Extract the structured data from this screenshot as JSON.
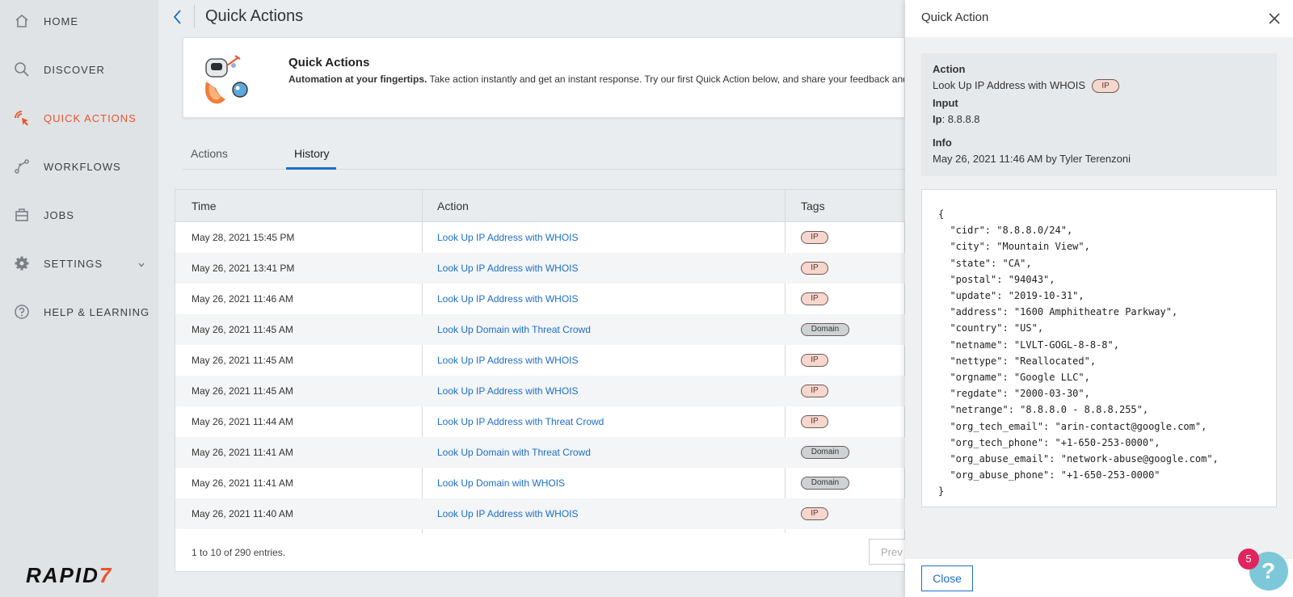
{
  "colors": {
    "accent": "#e8542b",
    "link": "#1c6ec6",
    "ip_tag": "#f6d6cd",
    "domain_tag": "#cfd2d4"
  },
  "sidebar": {
    "items": [
      {
        "label": "HOME",
        "icon": "home-icon",
        "active": false
      },
      {
        "label": "DISCOVER",
        "icon": "search-icon",
        "active": false
      },
      {
        "label": "QUICK ACTIONS",
        "icon": "cursor-click-icon",
        "active": true
      },
      {
        "label": "WORKFLOWS",
        "icon": "workflow-icon",
        "active": false
      },
      {
        "label": "JOBS",
        "icon": "briefcase-icon",
        "active": false
      },
      {
        "label": "SETTINGS",
        "icon": "gear-icon",
        "active": false
      },
      {
        "label": "HELP & LEARNING",
        "icon": "help-circle-icon",
        "active": false
      }
    ],
    "logo_text": "RAPID",
    "logo_seven": "7"
  },
  "header": {
    "title": "Quick Actions"
  },
  "banner": {
    "title": "Quick Actions",
    "lead": "Automation at your fingertips.",
    "text": " Take action instantly and get an instant response. Try our first Quick Action below, and share your feedback and ideas in the "
  },
  "tabs": [
    {
      "label": "Actions",
      "active": false
    },
    {
      "label": "History",
      "active": true
    }
  ],
  "table": {
    "headers": [
      "Time",
      "Action",
      "Tags"
    ],
    "rows": [
      {
        "time": "May 28, 2021 15:45 PM",
        "action": "Look Up IP Address with WHOIS",
        "tag": "IP"
      },
      {
        "time": "May 26, 2021 13:41 PM",
        "action": "Look Up IP Address with WHOIS",
        "tag": "IP"
      },
      {
        "time": "May 26, 2021 11:46 AM",
        "action": "Look Up IP Address with WHOIS",
        "tag": "IP"
      },
      {
        "time": "May 26, 2021 11:45 AM",
        "action": "Look Up Domain with Threat Crowd",
        "tag": "Domain"
      },
      {
        "time": "May 26, 2021 11:45 AM",
        "action": "Look Up IP Address with WHOIS",
        "tag": "IP"
      },
      {
        "time": "May 26, 2021 11:45 AM",
        "action": "Look Up IP Address with WHOIS",
        "tag": "IP"
      },
      {
        "time": "May 26, 2021 11:44 AM",
        "action": "Look Up IP Address with Threat Crowd",
        "tag": "IP"
      },
      {
        "time": "May 26, 2021 11:41 AM",
        "action": "Look Up Domain with Threat Crowd",
        "tag": "Domain"
      },
      {
        "time": "May 26, 2021 11:41 AM",
        "action": "Look Up Domain with WHOIS",
        "tag": "Domain"
      },
      {
        "time": "May 26, 2021 11:40 AM",
        "action": "Look Up IP Address with WHOIS",
        "tag": "IP"
      }
    ],
    "footer": "1 to 10 of 290 entries.",
    "prev_label": "Prev"
  },
  "drawer": {
    "title": "Quick Action",
    "action_label": "Action",
    "action_value": "Look Up IP Address with WHOIS",
    "action_tag": "IP",
    "input_label": "Input",
    "input_key": "Ip",
    "input_value": ": 8.8.8.8",
    "info_label": "Info",
    "info_value": "May 26, 2021 11:46 AM by Tyler Terenzoni",
    "json_lines": [
      "{",
      "  \"cidr\": \"8.8.8.0/24\",",
      "  \"city\": \"Mountain View\",",
      "  \"state\": \"CA\",",
      "  \"postal\": \"94043\",",
      "  \"update\": \"2019-10-31\",",
      "  \"address\": \"1600 Amphitheatre Parkway\",",
      "  \"country\": \"US\",",
      "  \"netname\": \"LVLT-GOGL-8-8-8\",",
      "  \"nettype\": \"Reallocated\",",
      "  \"orgname\": \"Google LLC\",",
      "  \"regdate\": \"2000-03-30\",",
      "  \"netrange\": \"8.8.8.0 - 8.8.8.255\",",
      "  \"org_tech_email\": \"arin-contact@google.com\",",
      "  \"org_tech_phone\": \"+1-650-253-0000\",",
      "  \"org_abuse_email\": \"network-abuse@google.com\",",
      "  \"org_abuse_phone\": \"+1-650-253-0000\"",
      "}"
    ],
    "close_label": "Close"
  },
  "help": {
    "badge_count": "5",
    "glyph": "?"
  }
}
